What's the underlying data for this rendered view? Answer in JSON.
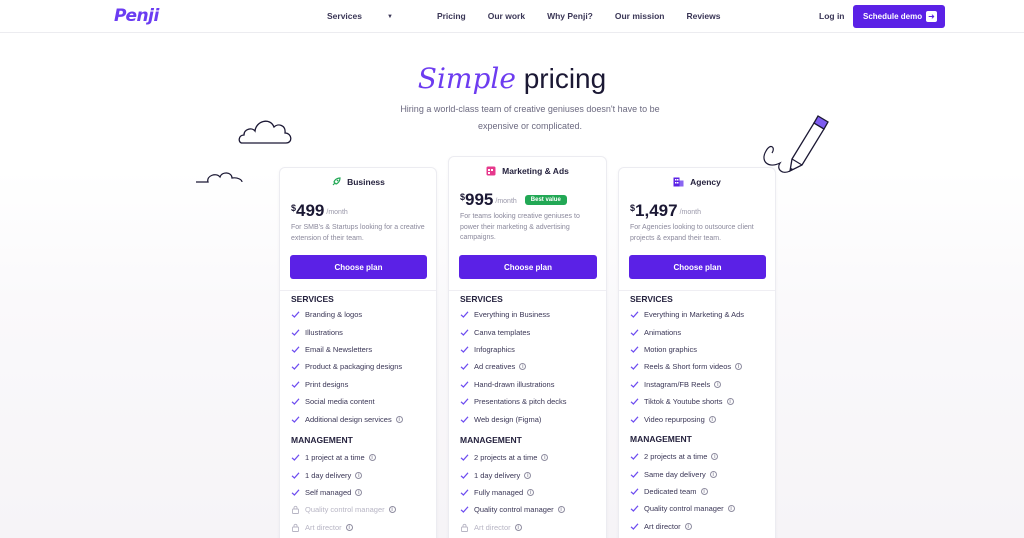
{
  "nav": {
    "logo": "Penji",
    "links": [
      "Services",
      "Pricing",
      "Our work",
      "Why Penji?",
      "Our mission",
      "Reviews"
    ],
    "login": "Log in",
    "cta": "Schedule demo"
  },
  "hero": {
    "title_script": "Simple",
    "title_rest": "pricing",
    "subtitle": "Hiring a world-class team of creative geniuses doesn't have to be expensive or complicated."
  },
  "colors": {
    "accent": "#5b21e6",
    "badge": "#22a855",
    "title_script": "#6d3cf0"
  },
  "plans": [
    {
      "name": "Business",
      "icon": "rocket-icon",
      "currency": "$",
      "price": "499",
      "period": "/month",
      "badge": "",
      "description": "For SMB's & Startups looking for a creative extension of their team.",
      "cta": "Choose plan",
      "services_title": "SERVICES",
      "services": [
        {
          "label": "Branding & logos",
          "info": false
        },
        {
          "label": "Illustrations",
          "info": false
        },
        {
          "label": "Email & Newsletters",
          "info": false
        },
        {
          "label": "Product & packaging designs",
          "info": false
        },
        {
          "label": "Print designs",
          "info": false
        },
        {
          "label": "Social media content",
          "info": false
        },
        {
          "label": "Additional design services",
          "info": true
        }
      ],
      "management_title": "MANAGEMENT",
      "management": [
        {
          "label": "1 project at a time",
          "info": true,
          "disabled": false
        },
        {
          "label": "1 day delivery",
          "info": true,
          "disabled": false
        },
        {
          "label": "Self managed",
          "info": true,
          "disabled": false
        },
        {
          "label": "Quality control manager",
          "info": true,
          "disabled": true
        },
        {
          "label": "Art director",
          "info": true,
          "disabled": true
        }
      ]
    },
    {
      "name": "Marketing & Ads",
      "icon": "calendar-icon",
      "currency": "$",
      "price": "995",
      "period": "/month",
      "badge": "Best value",
      "description": "For teams looking creative geniuses to power their marketing & advertising campaigns.",
      "cta": "Choose plan",
      "services_title": "SERVICES",
      "services": [
        {
          "label": "Everything in Business",
          "info": false
        },
        {
          "label": "Canva templates",
          "info": false
        },
        {
          "label": "Infographics",
          "info": false
        },
        {
          "label": "Ad creatives",
          "info": true
        },
        {
          "label": "Hand-drawn illustrations",
          "info": false
        },
        {
          "label": "Presentations & pitch decks",
          "info": false
        },
        {
          "label": "Web design (Figma)",
          "info": false
        }
      ],
      "management_title": "MANAGEMENT",
      "management": [
        {
          "label": "2 projects at a time",
          "info": true,
          "disabled": false
        },
        {
          "label": "1 day delivery",
          "info": true,
          "disabled": false
        },
        {
          "label": "Fully managed",
          "info": true,
          "disabled": false
        },
        {
          "label": "Quality control manager",
          "info": true,
          "disabled": false
        },
        {
          "label": "Art director",
          "info": true,
          "disabled": true
        }
      ]
    },
    {
      "name": "Agency",
      "icon": "building-icon",
      "currency": "$",
      "price": "1,497",
      "period": "/month",
      "badge": "",
      "description": "For Agencies looking to outsource client projects & expand their team.",
      "cta": "Choose plan",
      "services_title": "SERVICES",
      "services": [
        {
          "label": "Everything in Marketing & Ads",
          "info": false
        },
        {
          "label": "Animations",
          "info": false
        },
        {
          "label": "Motion graphics",
          "info": false
        },
        {
          "label": "Reels & Short form videos",
          "info": true
        },
        {
          "label": "Instagram/FB Reels",
          "info": true
        },
        {
          "label": "Tiktok & Youtube shorts",
          "info": true
        },
        {
          "label": "Video repurposing",
          "info": true
        }
      ],
      "management_title": "MANAGEMENT",
      "management": [
        {
          "label": "2 projects at a time",
          "info": true,
          "disabled": false
        },
        {
          "label": "Same day delivery",
          "info": true,
          "disabled": false
        },
        {
          "label": "Dedicated team",
          "info": true,
          "disabled": false
        },
        {
          "label": "Quality control manager",
          "info": true,
          "disabled": false
        },
        {
          "label": "Art director",
          "info": true,
          "disabled": false
        }
      ]
    }
  ]
}
